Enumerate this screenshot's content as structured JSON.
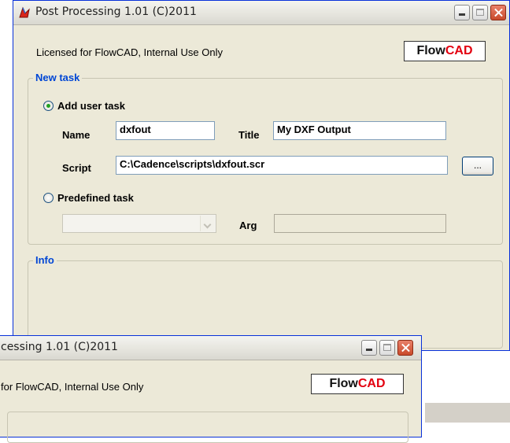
{
  "main_window": {
    "title": "Post Processing 1.01 (C)2011",
    "license_text": "Licensed for FlowCAD, Internal Use Only",
    "logo": {
      "part1": "Flow",
      "part2": "CAD"
    },
    "new_task": {
      "legend": "New task",
      "add_user_task": {
        "label": "Add user task",
        "checked": true
      },
      "name_label": "Name",
      "name_value": "dxfout",
      "title_label": "Title",
      "title_value": "My DXF Output",
      "script_label": "Script",
      "script_value": "C:\\Cadence\\scripts\\dxfout.scr",
      "browse_label": "...",
      "predefined_task": {
        "label": "Predefined task",
        "checked": false
      },
      "predefined_select_value": "",
      "arg_label": "Arg",
      "arg_value": ""
    },
    "info": {
      "legend": "Info"
    }
  },
  "second_window": {
    "title": "cessing 1.01 (C)2011",
    "license_text": "for FlowCAD, Internal Use Only",
    "logo": {
      "part1": "Flow",
      "part2": "CAD"
    }
  },
  "colors": {
    "window_bg": "#ece9d8",
    "legend_blue": "#0046d5",
    "logo_red": "#e3000f",
    "radio_checked": "#21a121"
  },
  "icons": [
    "app-icon",
    "minimize-icon",
    "maximize-icon",
    "close-icon",
    "chevron-down-icon"
  ]
}
